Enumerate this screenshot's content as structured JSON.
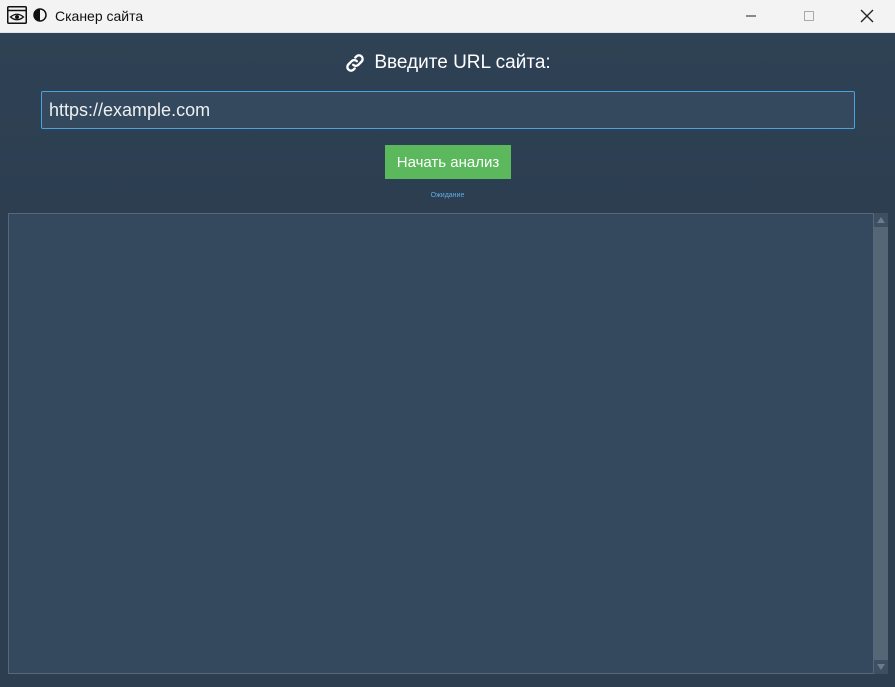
{
  "window": {
    "title": "Сканер сайта",
    "app_icon": "eye-window-icon",
    "theme_icon": "half-circle-contrast-icon",
    "controls": {
      "minimize_icon": "minimize-icon",
      "maximize_icon": "maximize-icon",
      "close_icon": "close-icon"
    }
  },
  "header": {
    "heading_icon": "link-icon",
    "heading": "Введите URL сайта:",
    "url_value": "https://example.com",
    "start_button_label": "Начать анализ",
    "status": "Ожидание"
  },
  "output": {
    "content": ""
  },
  "colors": {
    "background": "#2c3e50",
    "panel": "#34495e",
    "accent_green": "#5cb85c",
    "input_border": "#4aa3df",
    "status_text": "#5dade2"
  }
}
